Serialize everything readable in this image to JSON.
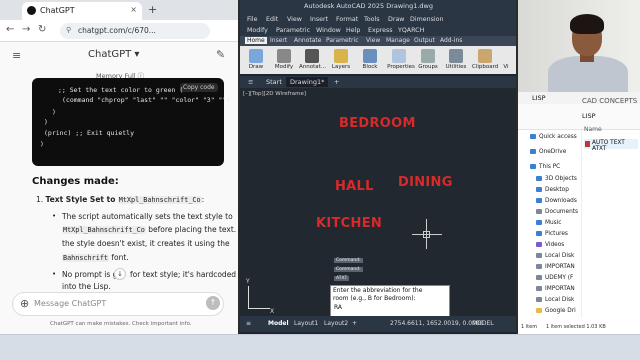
{
  "chrome": {
    "tab_title": "ChatGPT",
    "tab_close": "×",
    "new_tab": "+",
    "url": "chatgpt.com/c/670...",
    "nav_back": "←",
    "nav_forward": "→",
    "nav_reload": "↻"
  },
  "chatgpt": {
    "title": "ChatGPT ▾",
    "menu_icon": "≡",
    "edit_icon": "✎",
    "memory_tag": "Memory Full ⓘ",
    "copy_code": "Copy code",
    "code_lines": [
      ";; Set the text color to green (",
      "(command \"chprop\" \"last\" \"\" \"color\" \"3\" \"\")",
      ")",
      ")",
      "(princ) ;; Exit quietly",
      ")"
    ],
    "changes_heading": "Changes made:",
    "item1_num": "1.",
    "item1_title": "Text Style Set to",
    "item1_code": "MtXpl_Bahnschrift_Co",
    "item1_colon": ":",
    "sub1_line1": "The script automatically sets the text style to",
    "sub1_line2_code": "MtXpl_Bahnschrift_Co",
    "sub1_line2_text": "before placing the text. If",
    "sub1_line3": "the style doesn't exist, it creates it using the",
    "sub1_line4_code": "Bahnschrift",
    "sub1_line4_text": "font.",
    "sub2_line1a": "No prompt is gi",
    "sub2_line1b": "for text style; it's hardcoded",
    "sub2_line2": "into the Lisp.",
    "scroll_down": "↓",
    "message_placeholder": "Message ChatGPT",
    "attach_icon": "⊕",
    "send_icon": "↑",
    "disclaimer": "ChatGPT can make mistakes. Check important info."
  },
  "autocad": {
    "title": "Autodesk AutoCAD 2025   Drawing1.dwg",
    "menu_row1": [
      "File",
      "Edit",
      "View",
      "Insert",
      "Format",
      "Tools",
      "Draw",
      "Dimension"
    ],
    "menu_row2": [
      "Modify",
      "Parametric",
      "Window",
      "Help",
      "Express",
      "YQARCH"
    ],
    "ribbon_tabs": [
      "Home",
      "Insert",
      "Annotate",
      "Parametric",
      "View",
      "Manage",
      "Output",
      "Add-ins"
    ],
    "ribbon_buttons": [
      "Draw",
      "Modify",
      "Annotat...",
      "Layers",
      "Block",
      "Properties",
      "Groups",
      "Utilities",
      "Clipboard",
      "Vi"
    ],
    "file_tabs": [
      "Start",
      "Drawing1*"
    ],
    "file_tab_add": "+",
    "viewport_label": "[–][Top][2D Wireframe]",
    "rooms": [
      "BEDROOM",
      "HALL",
      "DINING",
      "KITCHEN"
    ],
    "cmd_history": [
      "Command:",
      "Command:",
      "ATXT"
    ],
    "cmd_prompt": [
      "Enter the abbreviation for the",
      "room (e.g., B for Bedroom):",
      "RA"
    ],
    "ucs_y": "Y",
    "ucs_x": "X",
    "layout_tabs": [
      "Model",
      "Layout1",
      "Layout2",
      "+"
    ],
    "coords": "2754.6611, 1652.0019, 0.0000",
    "model_label": "MODEL",
    "status_menu": "≡"
  },
  "explorer": {
    "title": "LISP",
    "path": "LISP",
    "folder_heading": "CAD CONCEPTS",
    "column_name": "Name",
    "file": "AUTO TEXT ATXT",
    "sidebar": [
      "Quick access",
      "OneDrive",
      "This PC",
      "3D Objects",
      "Desktop",
      "Downloads",
      "Documents",
      "Music",
      "Pictures",
      "Videos",
      "Local Disk",
      "IMPORTAN",
      "UDEMY (F",
      "IMPORTAN",
      "Local Disk",
      "Google Dri"
    ],
    "status_items": "1 item",
    "status_selected": "1 item selected  1.03 KB",
    "colors": {
      "folder": "#e9b949",
      "pc": "#3c7fd6",
      "drive": "#7a8899"
    }
  },
  "colors": {
    "room_text": "#d82a2a",
    "acad_bg": "#212830"
  }
}
